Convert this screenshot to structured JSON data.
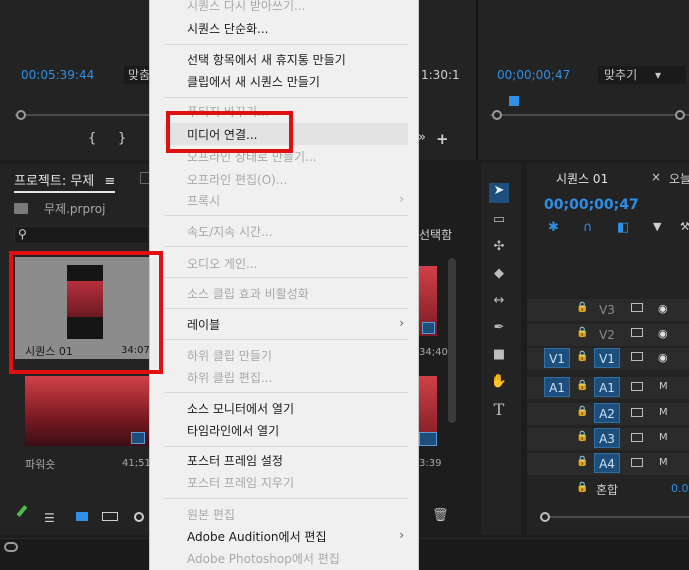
{
  "source": {
    "timecode": "00:05:39:44",
    "fit_label": "맞춤"
  },
  "program": {
    "timecode": "00;00;00;47",
    "fit_label": "맞추기",
    "fit_arrow": "▾",
    "partial_time": "1:30:1"
  },
  "project": {
    "tab_title": "프로젝트: 무제",
    "tab_menu": "≡",
    "file_name": "무제.prproj",
    "selection_label": "선택함",
    "search_placeholder": ""
  },
  "bins": [
    {
      "name": "시퀀스 01",
      "duration": "34:07"
    },
    {
      "name": "파워숏",
      "duration": "41;51"
    },
    {
      "name": "",
      "duration": "34;40"
    },
    {
      "name": "",
      "duration": "3:39"
    }
  ],
  "context_menu": {
    "items": [
      {
        "label": "시퀀스 다시 받아쓰기...",
        "enabled": false
      },
      {
        "label": "시퀀스 단순화...",
        "enabled": true
      },
      {
        "label": "선택 항목에서 새 휴지통 만들기",
        "enabled": true
      },
      {
        "label": "클립에서 새 시퀀스 만들기",
        "enabled": true
      },
      {
        "label": "푸티지 바꾸기...",
        "enabled": false
      },
      {
        "label": "미디어 연결...",
        "enabled": true
      },
      {
        "label": "오프라인 상태로 만들기...",
        "enabled": false
      },
      {
        "label": "오프라인 편집(O)...",
        "enabled": false
      },
      {
        "label": "프록시",
        "enabled": false
      },
      {
        "label": "속도/지속 시간...",
        "enabled": false
      },
      {
        "label": "오디오 게인...",
        "enabled": false
      },
      {
        "label": "소스 클립 효과 비활성화",
        "enabled": false
      },
      {
        "label": "레이블",
        "enabled": true
      },
      {
        "label": "하위 클립 만들기",
        "enabled": false
      },
      {
        "label": "하위 클립 편집...",
        "enabled": false
      },
      {
        "label": "소스 모니터에서 열기",
        "enabled": true
      },
      {
        "label": "타임라인에서 열기",
        "enabled": true
      },
      {
        "label": "포스터 프레임 설정",
        "enabled": true
      },
      {
        "label": "포스터 프레임 지우기",
        "enabled": false
      },
      {
        "label": "원본 편집",
        "enabled": false
      },
      {
        "label": "Adobe Audition에서 편집",
        "enabled": true
      },
      {
        "label": "Adobe Photoshop에서 편집",
        "enabled": false
      }
    ]
  },
  "timeline": {
    "tab_title": "시퀀스 01",
    "tab_close": "×",
    "next_tab": "오늘",
    "timecode": "00;00;00;47",
    "tracks": [
      {
        "name": "V3",
        "src": ""
      },
      {
        "name": "V2",
        "src": ""
      },
      {
        "name": "V1",
        "src": "V1"
      },
      {
        "name": "A1",
        "src": "A1"
      },
      {
        "name": "A2",
        "src": ""
      },
      {
        "name": "A3",
        "src": ""
      },
      {
        "name": "A4",
        "src": ""
      }
    ],
    "mix_label": "혼합",
    "mix_value": "0.0"
  },
  "colors": {
    "accent": "#2f8ee6",
    "highlight_red": "#e01010",
    "track_selected": "#1e4f7c"
  }
}
